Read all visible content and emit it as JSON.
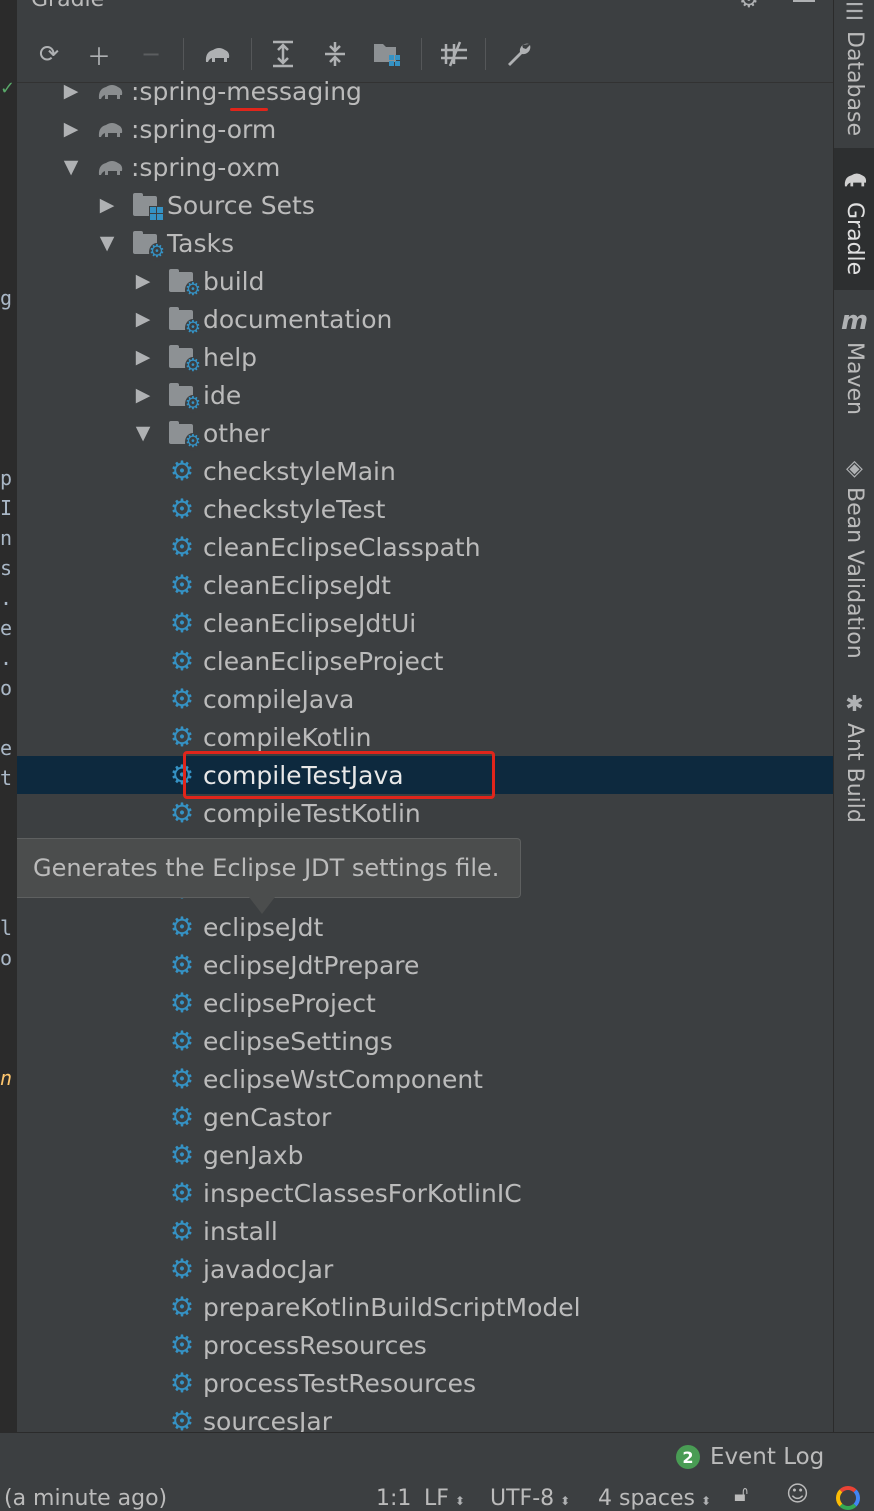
{
  "panel": {
    "title": "Gradle"
  },
  "toolbar": {
    "refresh_icon": "refresh-icon",
    "add_icon": "plus-icon",
    "remove_icon": "minus-icon",
    "run_icon": "gradle-elephant-icon",
    "expand_icon": "expand-all-icon",
    "collapse_icon": "collapse-all-icon",
    "group_icon": "group-modules-icon",
    "offline_icon": "toggle-offline-icon",
    "settings_icon": "wrench-icon"
  },
  "tree": {
    "rows": [
      {
        "label": ":spring-messaging",
        "icon": "elephant",
        "level": 0,
        "state": "collapsed"
      },
      {
        "label": ":spring-orm",
        "icon": "elephant",
        "level": 0,
        "state": "collapsed"
      },
      {
        "label": ":spring-oxm",
        "icon": "elephant",
        "level": 0,
        "state": "expanded"
      },
      {
        "label": "Source Sets",
        "icon": "folder-grid",
        "level": 1,
        "state": "collapsed"
      },
      {
        "label": "Tasks",
        "icon": "folder-gear",
        "level": 1,
        "state": "expanded"
      },
      {
        "label": "build",
        "icon": "folder-gear",
        "level": 2,
        "state": "collapsed"
      },
      {
        "label": "documentation",
        "icon": "folder-gear",
        "level": 2,
        "state": "collapsed"
      },
      {
        "label": "help",
        "icon": "folder-gear",
        "level": 2,
        "state": "collapsed"
      },
      {
        "label": "ide",
        "icon": "folder-gear",
        "level": 2,
        "state": "collapsed"
      },
      {
        "label": "other",
        "icon": "folder-gear",
        "level": 2,
        "state": "expanded"
      },
      {
        "label": "checkstyleMain",
        "icon": "task",
        "level": 3,
        "state": "leaf"
      },
      {
        "label": "checkstyleTest",
        "icon": "task",
        "level": 3,
        "state": "leaf"
      },
      {
        "label": "cleanEclipseClasspath",
        "icon": "task",
        "level": 3,
        "state": "leaf"
      },
      {
        "label": "cleanEclipseJdt",
        "icon": "task",
        "level": 3,
        "state": "leaf"
      },
      {
        "label": "cleanEclipseJdtUi",
        "icon": "task",
        "level": 3,
        "state": "leaf"
      },
      {
        "label": "cleanEclipseProject",
        "icon": "task",
        "level": 3,
        "state": "leaf"
      },
      {
        "label": "compileJava",
        "icon": "task",
        "level": 3,
        "state": "leaf"
      },
      {
        "label": "compileKotlin",
        "icon": "task",
        "level": 3,
        "state": "leaf"
      },
      {
        "label": "compileTestJava",
        "icon": "task",
        "level": 3,
        "state": "leaf",
        "selected": true
      },
      {
        "label": "compileTestKotlin",
        "icon": "task",
        "level": 3,
        "state": "leaf"
      },
      {
        "label": "",
        "icon": "task",
        "level": 3,
        "state": "leaf",
        "hidden_by_tooltip": true
      },
      {
        "label": "",
        "icon": "task",
        "level": 3,
        "state": "leaf",
        "hidden_by_tooltip": true
      },
      {
        "label": "eclipseJdt",
        "icon": "task",
        "level": 3,
        "state": "leaf"
      },
      {
        "label": "eclipseJdtPrepare",
        "icon": "task",
        "level": 3,
        "state": "leaf"
      },
      {
        "label": "eclipseProject",
        "icon": "task",
        "level": 3,
        "state": "leaf"
      },
      {
        "label": "eclipseSettings",
        "icon": "task",
        "level": 3,
        "state": "leaf"
      },
      {
        "label": "eclipseWstComponent",
        "icon": "task",
        "level": 3,
        "state": "leaf"
      },
      {
        "label": "genCastor",
        "icon": "task",
        "level": 3,
        "state": "leaf"
      },
      {
        "label": "genJaxb",
        "icon": "task",
        "level": 3,
        "state": "leaf"
      },
      {
        "label": "inspectClassesForKotlinIC",
        "icon": "task",
        "level": 3,
        "state": "leaf"
      },
      {
        "label": "install",
        "icon": "task",
        "level": 3,
        "state": "leaf"
      },
      {
        "label": "javadocJar",
        "icon": "task",
        "level": 3,
        "state": "leaf"
      },
      {
        "label": "prepareKotlinBuildScriptModel",
        "icon": "task",
        "level": 3,
        "state": "leaf"
      },
      {
        "label": "processResources",
        "icon": "task",
        "level": 3,
        "state": "leaf"
      },
      {
        "label": "processTestResources",
        "icon": "task",
        "level": 3,
        "state": "leaf"
      },
      {
        "label": "sourcesJar",
        "icon": "task",
        "level": 3,
        "state": "leaf"
      }
    ]
  },
  "tooltip": {
    "text": "Generates the Eclipse JDT settings file."
  },
  "side_tabs": [
    {
      "label": "Database",
      "icon": "database-icon",
      "active": false
    },
    {
      "label": "Gradle",
      "icon": "gradle-elephant-icon",
      "active": true
    },
    {
      "label": "Maven",
      "icon": "maven-icon",
      "active": false
    },
    {
      "label": "Bean Validation",
      "icon": "bean-validation-icon",
      "active": false
    },
    {
      "label": "Ant Build",
      "icon": "ant-icon",
      "active": false
    }
  ],
  "event_log": {
    "count": "2",
    "label": "Event Log"
  },
  "status_bar": {
    "message": "(a minute ago)",
    "position": "1:1",
    "line_sep": "LF",
    "encoding": "UTF-8",
    "indent": "4 spaces"
  },
  "editor_fragments": [
    "g",
    "p",
    "I",
    "n",
    "s",
    ".",
    "e",
    ".",
    "o",
    "e",
    "t",
    "l",
    "o",
    "n"
  ],
  "colors": {
    "selection": "#0d293e",
    "highlight_box": "#e0251b",
    "task_icon": "#3592c4",
    "event_badge": "#499c54"
  }
}
